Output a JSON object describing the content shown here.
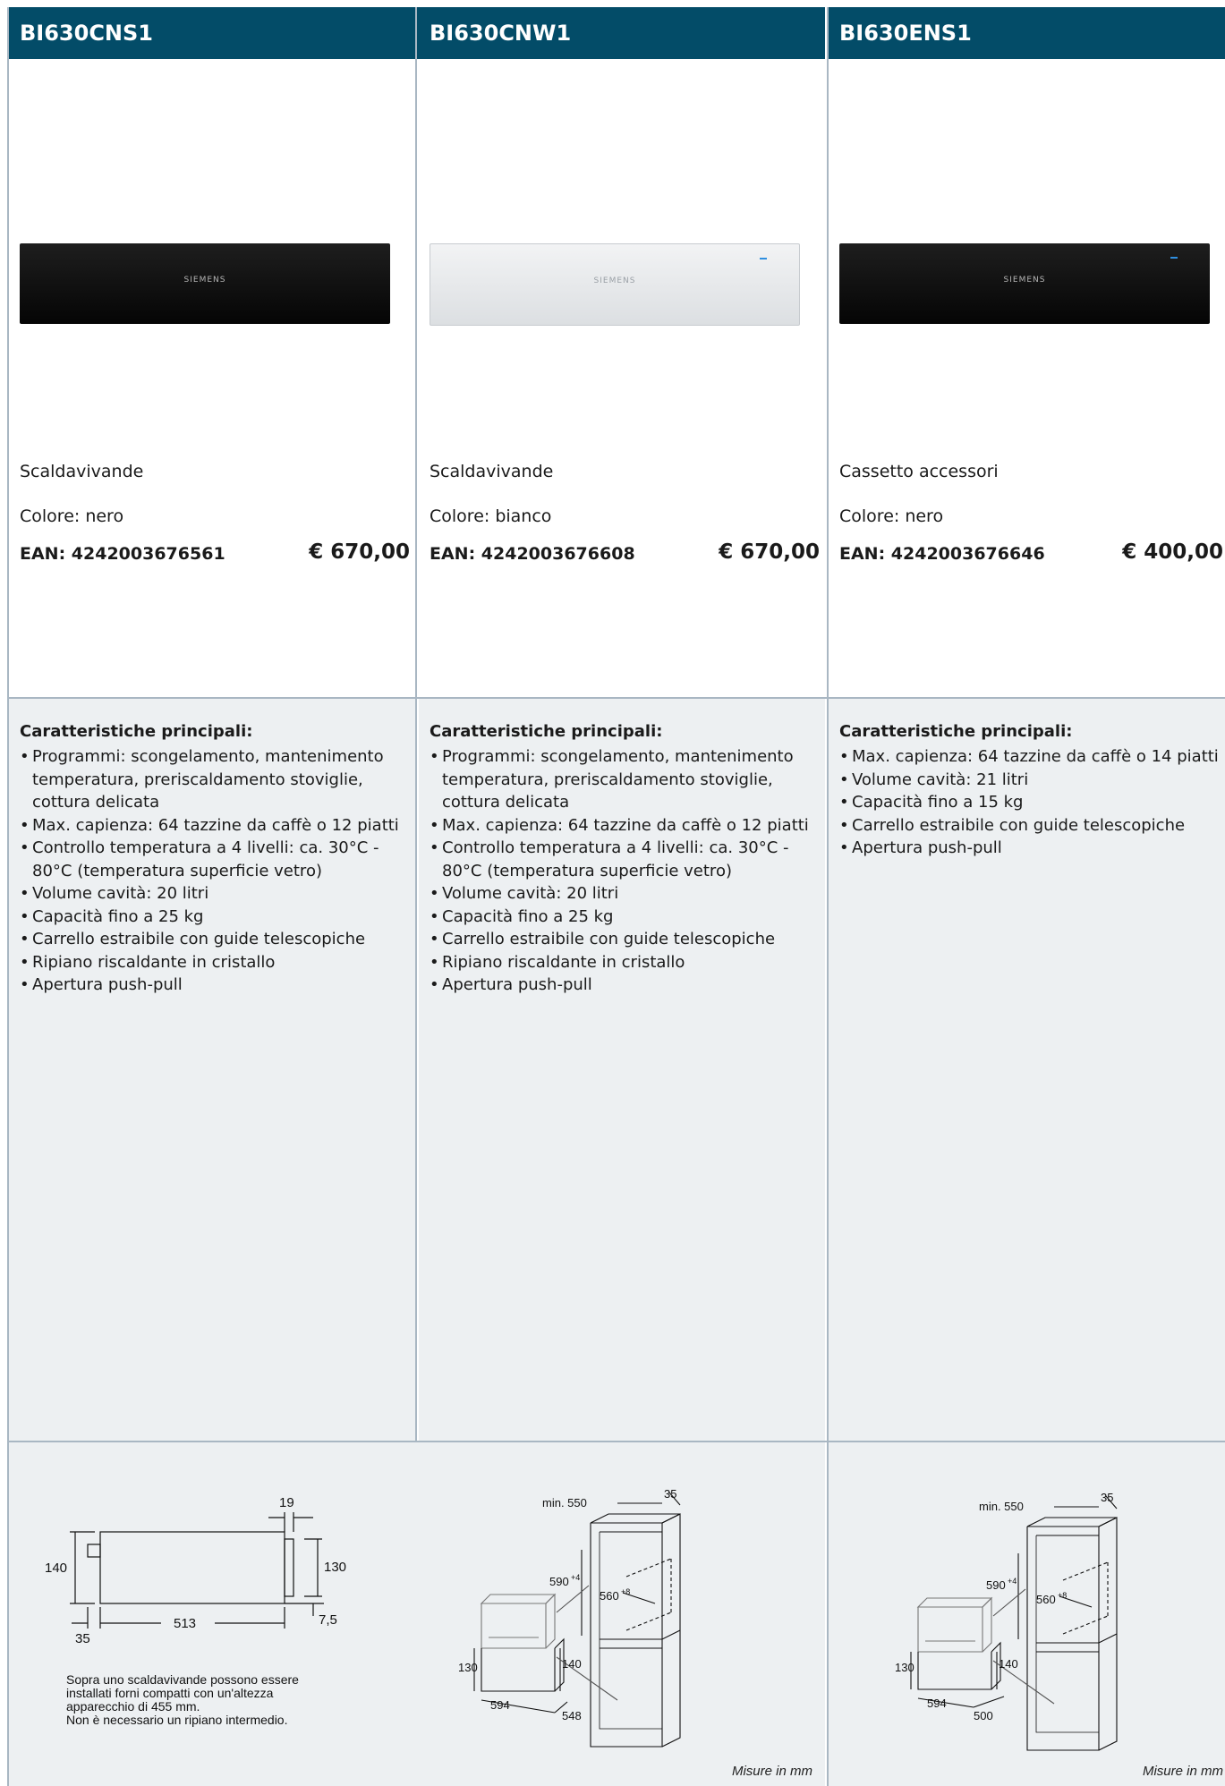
{
  "products": [
    {
      "code": "BI630CNS1",
      "finish": "black",
      "brand_mark": "SIEMENS",
      "category": "Scaldavivande",
      "color": "Colore: nero",
      "ean": "EAN: 4242003676561",
      "price": "€ 670,00",
      "features_title": "Caratteristiche principali:",
      "features": [
        "Programmi: scongelamento, mantenimento temperatura, preriscaldamento stoviglie, cottura delicata",
        "Max. capienza: 64 tazzine da caffè o 12 piatti",
        "Controllo temperatura a 4 livelli: ca. 30°C - 80°C (temperatura superficie vetro)",
        "Volume cavità: 20 litri",
        "Capacità fino a 25 kg",
        "Carrello estraibile con guide telescopiche",
        "Ripiano riscaldante in cristallo",
        "Apertura push-pull"
      ]
    },
    {
      "code": "BI630CNW1",
      "finish": "white",
      "brand_mark": "SIEMENS",
      "category": "Scaldavivande",
      "color": "Colore: bianco",
      "ean": "EAN: 4242003676608",
      "price": "€ 670,00",
      "features_title": "Caratteristiche principali:",
      "features": [
        "Programmi: scongelamento, mantenimento temperatura, preriscaldamento stoviglie, cottura delicata",
        "Max. capienza: 64 tazzine da caffè o 12 piatti",
        "Controllo temperatura a 4 livelli: ca. 30°C - 80°C (temperatura superficie vetro)",
        "Volume cavità: 20 litri",
        "Capacità fino a 25 kg",
        "Carrello estraibile con guide telescopiche",
        "Ripiano riscaldante in cristallo",
        "Apertura push-pull"
      ]
    },
    {
      "code": "BI630ENS1",
      "finish": "black",
      "brand_mark": "SIEMENS",
      "category": "Cassetto accessori",
      "color": "Colore: nero",
      "ean": "EAN: 4242003676646",
      "price": "€ 400,00",
      "features_title": "Caratteristiche principali:",
      "features": [
        "Max. capienza: 64 tazzine da caffè o 14 piatti",
        "Volume cavità: 21 litri",
        "Capacità fino a 15 kg",
        "Carrello estraibile con guide telescopiche",
        "Apertura push-pull"
      ]
    }
  ],
  "drawings": {
    "side_view": {
      "dim_19": "19",
      "dim_140": "140",
      "dim_130": "130",
      "dim_7_5": "7,5",
      "dim_513": "513",
      "dim_35": "35"
    },
    "note": [
      "Sopra uno scaldavivande possono essere",
      "installati forni compatti con un'altezza",
      "apparecchio di 455 mm.",
      "Non è necessario un ripiano intermedio."
    ],
    "install_a": {
      "min550": "min. 550",
      "d35": "35",
      "h590": "590",
      "h590_sup": "+4",
      "w560": "560",
      "w560_sup": "+8",
      "h130": "130",
      "h140": "140",
      "w594": "594",
      "d548": "548"
    },
    "install_b": {
      "min550": "min. 550",
      "d35": "35",
      "h590": "590",
      "h590_sup": "+4",
      "w560": "560",
      "w560_sup": "+8",
      "h130": "130",
      "h140": "140",
      "w594": "594",
      "d500": "500"
    },
    "units_note": "Misure in mm"
  }
}
